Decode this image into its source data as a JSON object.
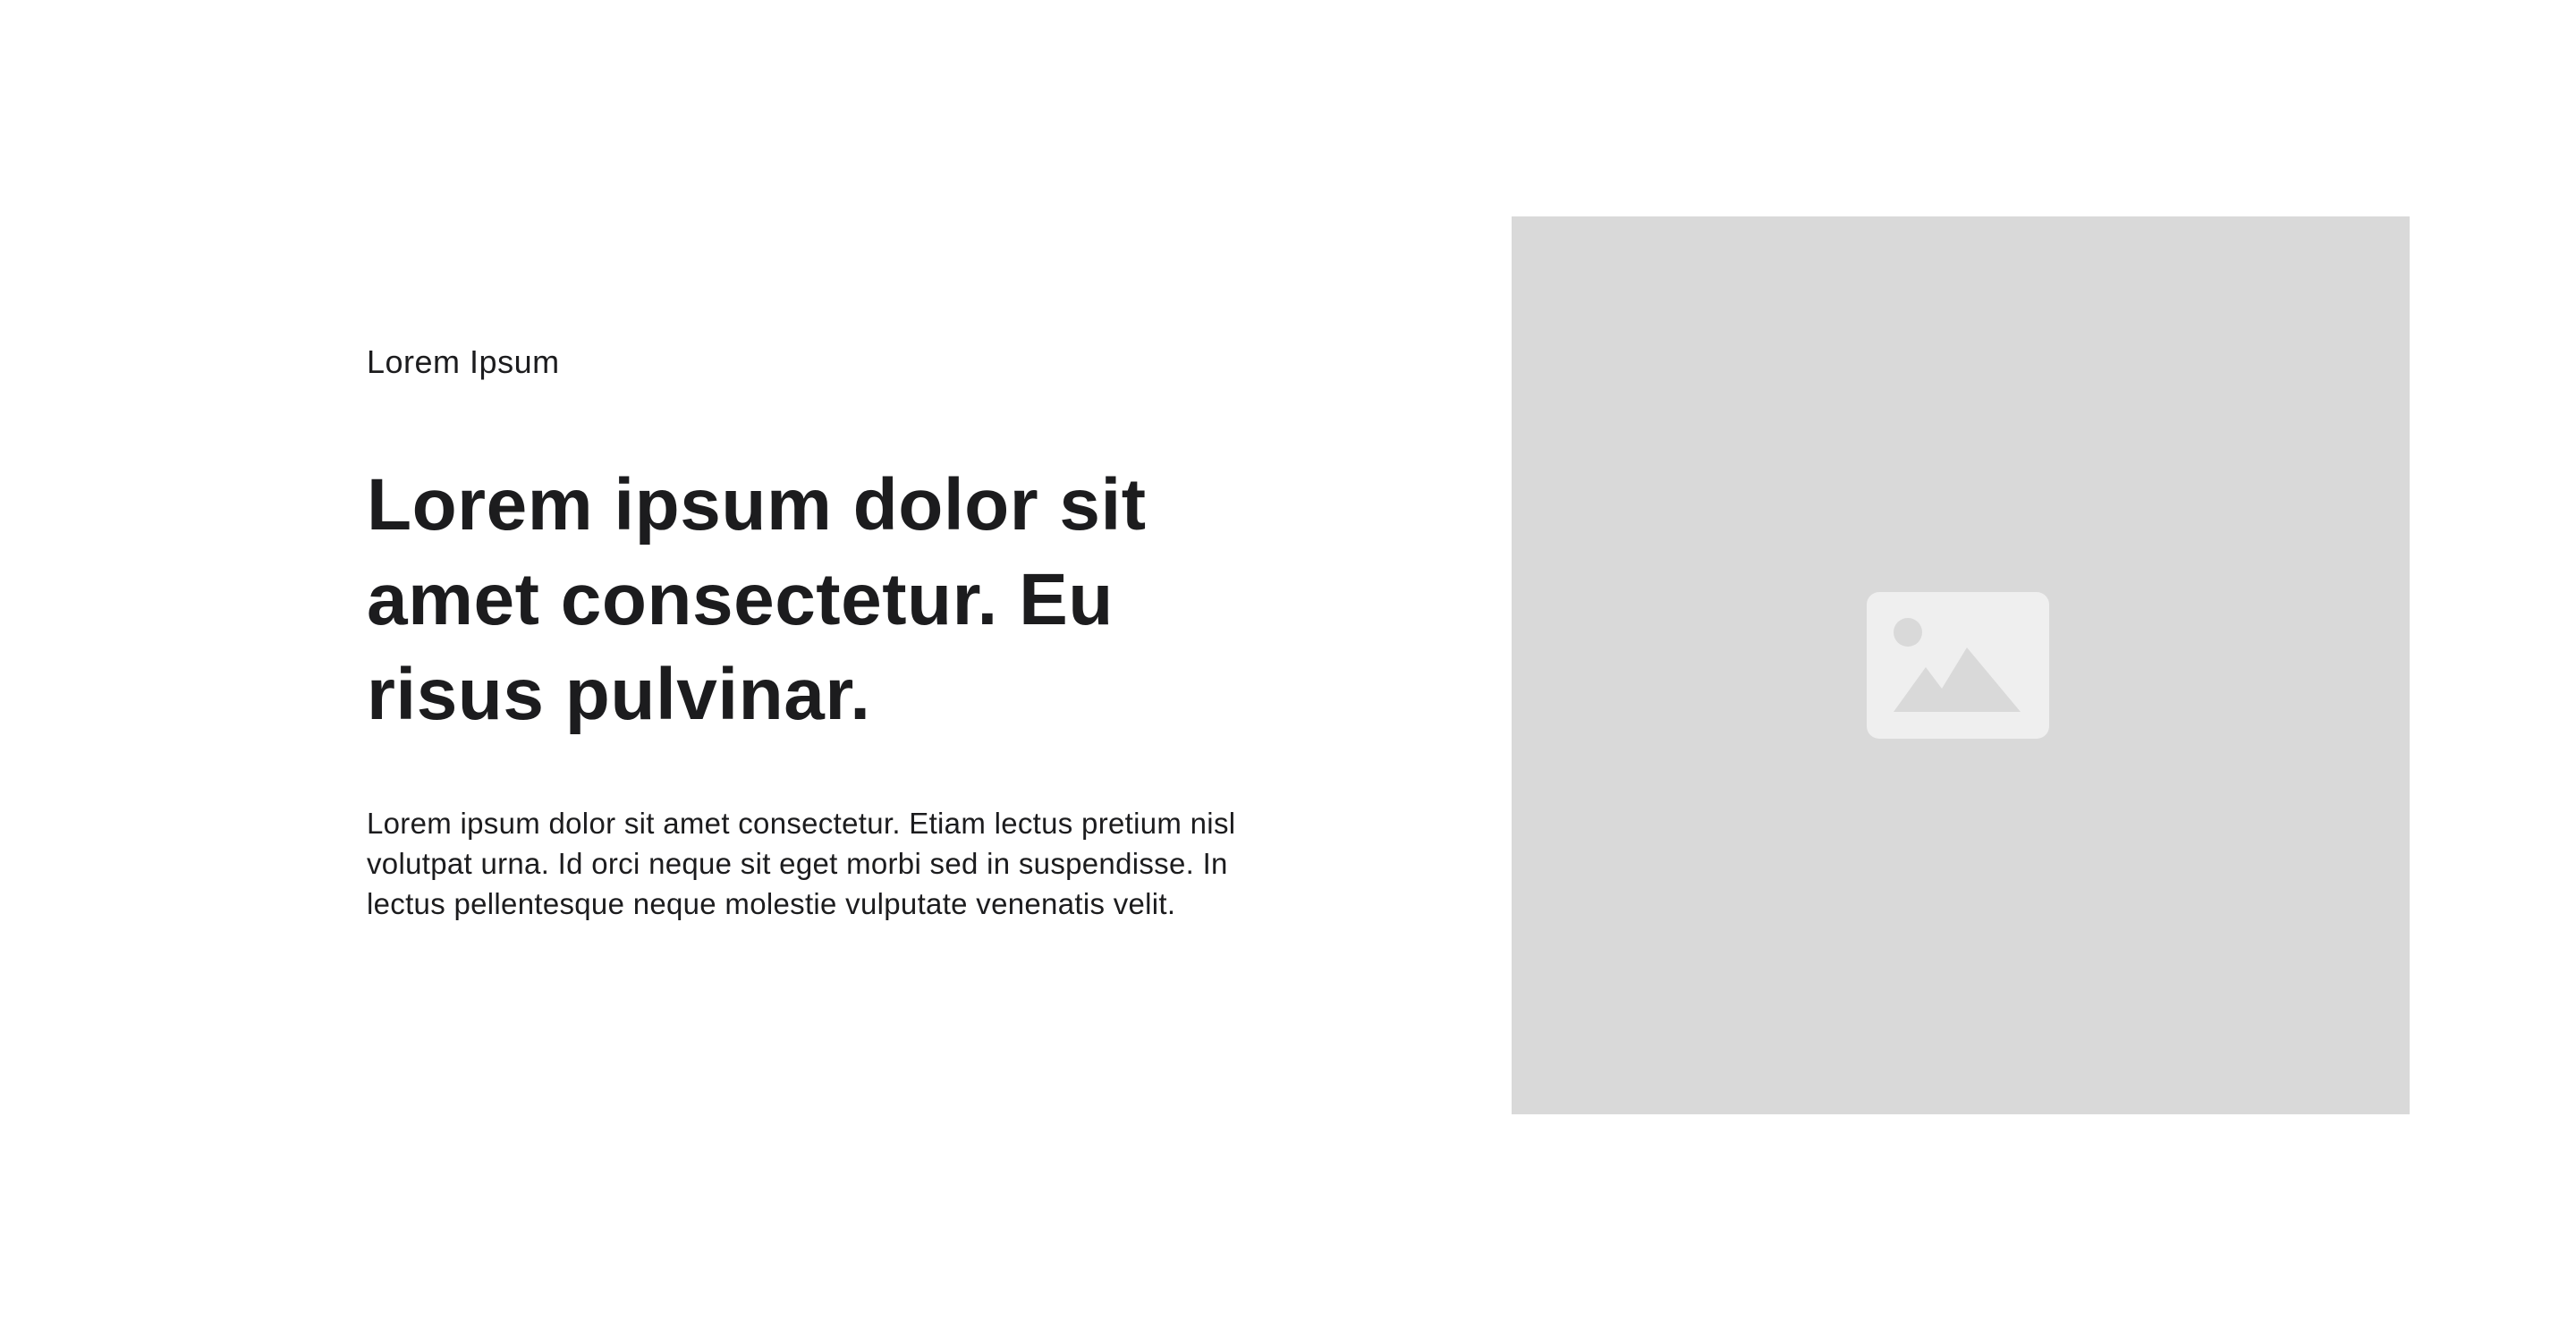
{
  "hero": {
    "eyebrow": "Lorem Ipsum",
    "headline": "Lorem ipsum dolor sit amet consectetur. Eu risus pulvinar.",
    "body": "Lorem ipsum dolor sit amet consectetur. Etiam lectus pretium nisl volutpat urna. Id orci neque sit eget morbi sed in suspendisse. In lectus pellentesque neque molestie vulputate venenatis velit."
  },
  "media": {
    "icon": "image-placeholder-icon",
    "background_color": "#d9d9d9",
    "icon_color": "#efefef"
  },
  "colors": {
    "text": "#1c1c1e",
    "page_background": "#ffffff"
  }
}
